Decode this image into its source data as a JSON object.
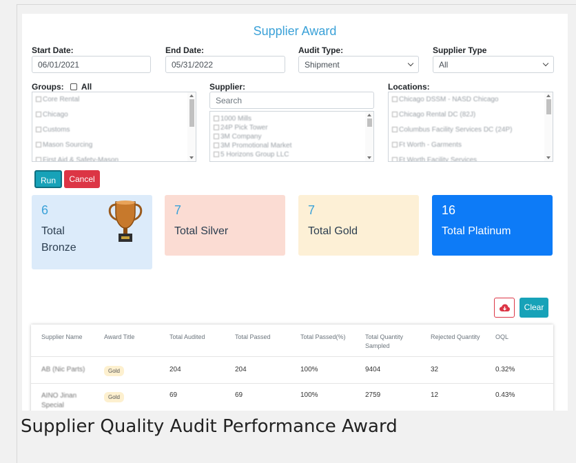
{
  "title": "Supplier Award",
  "filters": {
    "start_date": {
      "label": "Start Date:",
      "value": "06/01/2021"
    },
    "end_date": {
      "label": "End Date:",
      "value": "05/31/2022"
    },
    "audit_type": {
      "label": "Audit Type:",
      "value": "Shipment"
    },
    "supplier_type": {
      "label": "Supplier Type",
      "value": "All"
    },
    "groups": {
      "label": "Groups:",
      "all_label": "All",
      "items": [
        "Core Rental",
        "Chicago",
        "Customs",
        "Mason Sourcing",
        "First Aid & Safety-Mason"
      ]
    },
    "supplier": {
      "label": "Supplier:",
      "search_placeholder": "Search",
      "items": [
        "1000 Mills",
        "24P Pick Tower",
        "3M Company",
        "3M Promotional Market",
        "5 Horizons Group LLC"
      ]
    },
    "locations": {
      "label": "Locations:",
      "items": [
        "Chicago DSSM - NASD Chicago",
        "Chicago Rental DC (82J)",
        "Columbus Facility Services DC (24P)",
        "Ft Worth - Garments",
        "Ft Worth Facility Services"
      ]
    }
  },
  "actions": {
    "run": "Run",
    "cancel": "Cancel",
    "clear": "Clear",
    "export_icon": "cloud-download-icon"
  },
  "cards": [
    {
      "count": "6",
      "label": "Total Bronze",
      "bg": "#dcebfa",
      "color": "#2c3e50",
      "count_color": "#3aa1d8",
      "icon": "trophy-icon"
    },
    {
      "count": "7",
      "label": "Total Silver",
      "bg": "#fbdcd3",
      "color": "#2c3e50",
      "count_color": "#3aa1d8"
    },
    {
      "count": "7",
      "label": "Total Gold",
      "bg": "#fdf0d6",
      "color": "#2c3e50",
      "count_color": "#3aa1d8"
    },
    {
      "count": "16",
      "label": "Total Platinum",
      "bg": "#0d7bf7",
      "color": "#ffffff",
      "count_color": "#ffffff"
    }
  ],
  "table": {
    "headers": [
      "Supplier Name",
      "Award Title",
      "Total Audited",
      "Total Passed",
      "Total Passed(%)",
      "Total Quantity Sampled",
      "Rejected Quantity",
      "OQL"
    ],
    "rows": [
      {
        "supplier": "AB (Nic Parts)",
        "award": "Gold",
        "audited": "204",
        "passed": "204",
        "passed_pct": "100%",
        "sampled": "9404",
        "rejected": "32",
        "oql": "0.32%"
      },
      {
        "supplier": "AINO Jinan Special",
        "award": "Gold",
        "audited": "69",
        "passed": "69",
        "passed_pct": "100%",
        "sampled": "2759",
        "rejected": "12",
        "oql": "0.43%"
      }
    ]
  },
  "caption": "Supplier Quality Audit Performance Award",
  "colors": {
    "accent": "#3aa1d8",
    "run": "#17a2b8",
    "cancel": "#dc3545",
    "clear": "#17a2b8"
  }
}
